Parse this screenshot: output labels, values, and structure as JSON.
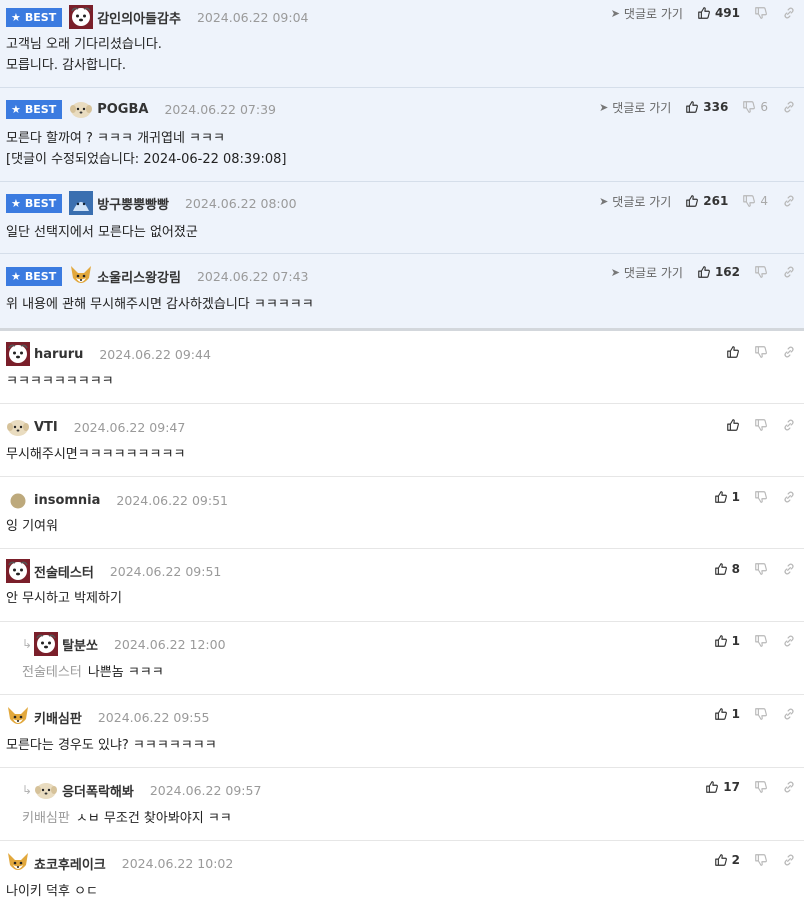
{
  "labels": {
    "best": "BEST",
    "goto": "댓글로 가기"
  },
  "comments": [
    {
      "nick": "감인의아들감추",
      "date": "2024.06.22 09:04",
      "lines": [
        "고객님 오래 기다리셨습니다.",
        "모릅니다. 감사합니다."
      ],
      "likes": "491",
      "dislikes": ""
    },
    {
      "nick": "POGBA",
      "date": "2024.06.22 07:39",
      "lines": [
        "모른다 할까여 ? ㅋㅋㅋ 개귀엽네 ㅋㅋㅋ",
        "[댓글이 수정되었습니다: 2024-06-22 08:39:08]"
      ],
      "likes": "336",
      "dislikes": "6"
    },
    {
      "nick": "방구뿡뿡빵빵",
      "date": "2024.06.22 08:00",
      "lines": [
        "일단 선택지에서 모른다는 없어졌군"
      ],
      "likes": "261",
      "dislikes": "4"
    },
    {
      "nick": "소울리스왕강림",
      "date": "2024.06.22 07:43",
      "lines": [
        "위 내용에 관해 무시해주시면 감사하겠습니다 ㅋㅋㅋㅋㅋ"
      ],
      "likes": "162",
      "dislikes": ""
    },
    {
      "nick": "haruru",
      "date": "2024.06.22 09:44",
      "lines": [
        "ㅋㅋㅋㅋㅋㅋㅋㅋㅋ"
      ],
      "likes": "",
      "dislikes": ""
    },
    {
      "nick": "VTI",
      "date": "2024.06.22 09:47",
      "lines": [
        "무시해주시면ㅋㅋㅋㅋㅋㅋㅋㅋㅋ"
      ],
      "likes": "",
      "dislikes": ""
    },
    {
      "nick": "insomnia",
      "date": "2024.06.22 09:51",
      "lines": [
        "잉 기여워"
      ],
      "likes": "1",
      "dislikes": ""
    },
    {
      "nick": "전술테스터",
      "date": "2024.06.22 09:51",
      "lines": [
        "안 무시하고 박제하기"
      ],
      "likes": "8",
      "dislikes": ""
    },
    {
      "nick": "탈분쏘",
      "date": "2024.06.22 12:00",
      "quote": "전술테스터",
      "lines": [
        "나쁜놈 ㅋㅋㅋ"
      ],
      "likes": "1",
      "dislikes": ""
    },
    {
      "nick": "키배심판",
      "date": "2024.06.22 09:55",
      "lines": [
        "모른다는 경우도 있냐? ㅋㅋㅋㅋㅋㅋㅋ"
      ],
      "likes": "1",
      "dislikes": ""
    },
    {
      "nick": "응더폭락해봐",
      "date": "2024.06.22 09:57",
      "quote": "키배심판",
      "lines": [
        "ㅅㅂ 무조건 찾아봐야지 ㅋㅋ"
      ],
      "likes": "17",
      "dislikes": ""
    },
    {
      "nick": "쵸코후레이크",
      "date": "2024.06.22 10:02",
      "lines": [
        "나이키 덕후 ㅇㄷ"
      ],
      "likes": "2",
      "dislikes": ""
    }
  ],
  "colors": {
    "best_bg": "#eef3fb",
    "badge": "#3b7be0"
  }
}
